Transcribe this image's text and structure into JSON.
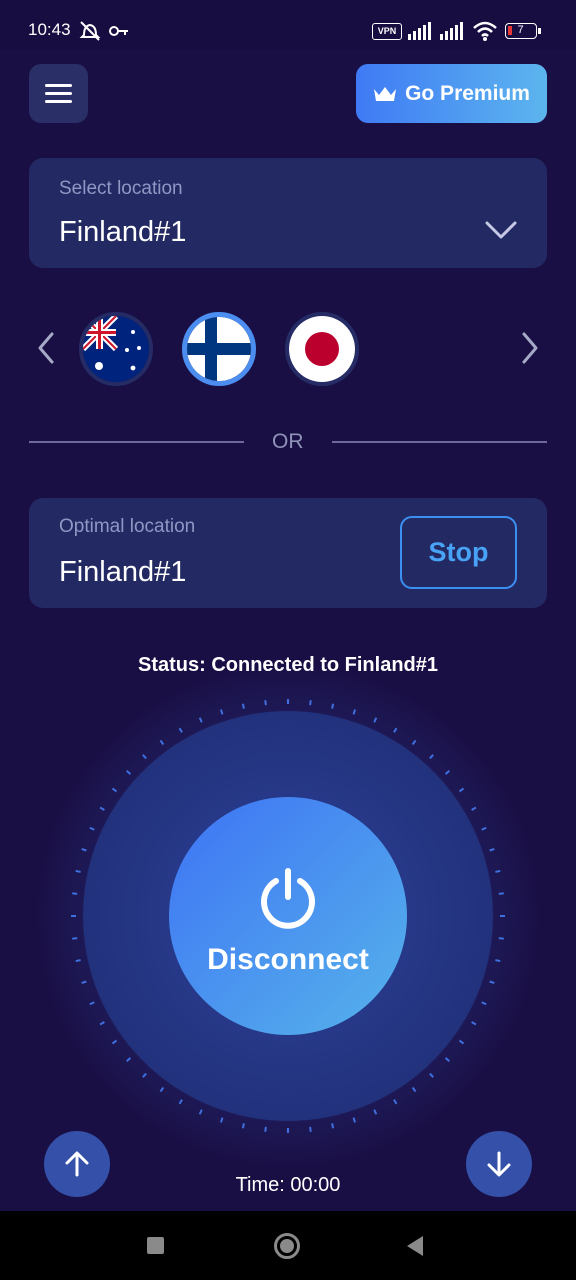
{
  "status_bar": {
    "time": "10:43",
    "vpn_badge": "VPN",
    "battery_level": "7",
    "icons": [
      "mute-icon",
      "vpn-key-icon",
      "signal-icon",
      "signal-icon",
      "wifi-icon",
      "battery-icon"
    ]
  },
  "header": {
    "menu_icon": "hamburger-icon",
    "premium_label": "Go Premium",
    "premium_icon": "crown-icon"
  },
  "select_location": {
    "caption": "Select location",
    "value": "Finland#1"
  },
  "flags": {
    "items": [
      "Australia",
      "Finland",
      "Japan"
    ],
    "selected": "Finland"
  },
  "divider": {
    "label": "OR"
  },
  "optimal_location": {
    "caption": "Optimal location",
    "value": "Finland#1",
    "stop_label": "Stop"
  },
  "status": {
    "text": "Status: Connected to Finland#1"
  },
  "connect_button": {
    "label": "Disconnect",
    "icon": "power-icon"
  },
  "timer": {
    "text": "Time: 00:00"
  },
  "colors": {
    "background": "#1a0f45",
    "card": "#232a63",
    "accent_start": "#3f7af5",
    "accent_end": "#5cb5ee",
    "stop_border": "#3b8ff0"
  }
}
